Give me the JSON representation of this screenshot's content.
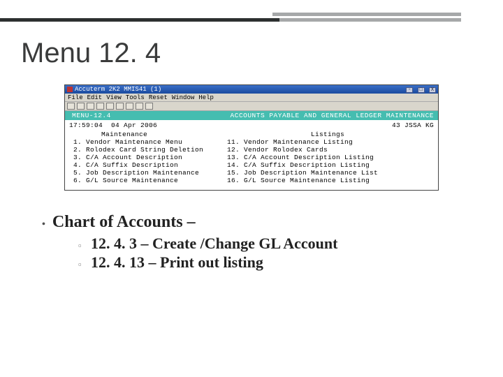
{
  "slide": {
    "title": "Menu 12. 4"
  },
  "window": {
    "title": "Accuterm 2K2  MMIS41 (1)",
    "menubar": [
      "File",
      "Edit",
      "View",
      "Tools",
      "Reset",
      "Window",
      "Help"
    ],
    "close": "X",
    "min": "-",
    "max": "□"
  },
  "term": {
    "header_left": "MENU-12.4",
    "header_right": "ACCOUNTS PAYABLE AND GENERAL LEDGER MAINTENANCE",
    "timestamp": "17:59:04  04 Apr 2006",
    "site": "43 JSSA KG",
    "section_left": "Maintenance",
    "section_right": "Listings",
    "left": [
      {
        "n": "1",
        "t": "Vendor Maintenance Menu"
      },
      {
        "n": "2",
        "t": "Rolodex Card String Deletion"
      },
      {
        "n": "3",
        "t": "C/A Account Description"
      },
      {
        "n": "4",
        "t": "C/A Suffix Description"
      },
      {
        "n": "5",
        "t": "Job Description Maintenance"
      },
      {
        "n": "6",
        "t": "G/L Source Maintenance"
      }
    ],
    "right": [
      {
        "n": "11",
        "t": "Vendor Maintenance Listing"
      },
      {
        "n": "12",
        "t": "Vendor Rolodex Cards"
      },
      {
        "n": "13",
        "t": "C/A Account Description Listing"
      },
      {
        "n": "14",
        "t": "C/A Suffix Description Listing"
      },
      {
        "n": "15",
        "t": "Job Description Maintenance List"
      },
      {
        "n": "16",
        "t": "G/L Source Maintenance Listing"
      }
    ]
  },
  "bullets": {
    "main": "Chart of Accounts –",
    "subs": [
      "12. 4. 3 – Create /Change GL Account",
      "12. 4. 13 – Print out listing"
    ]
  }
}
